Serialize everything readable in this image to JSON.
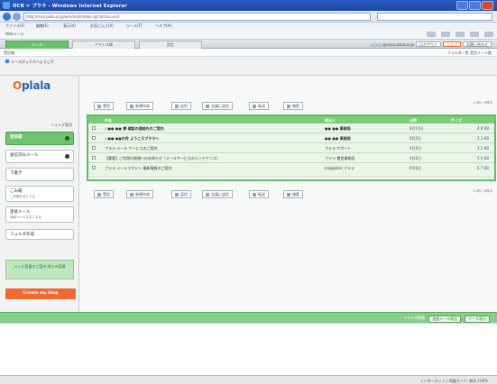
{
  "browser": {
    "title": "OCN  > プララ - Windows Internet Explorer",
    "address": "http://mail.plala.or.jp/wm/mail/index.cgi?action=list",
    "menus": [
      "ファイル(F)",
      "編集(E)",
      "表示(V)",
      "お気に入り(A)",
      "ツール(T)",
      "ヘルプ(H)"
    ],
    "favorite": "Webメール"
  },
  "header": {
    "tabs": [
      "メール",
      "アドレス帳",
      "設定"
    ],
    "links": [
      "ログアウト",
      "ヘルプ",
      "お問い合わせ"
    ],
    "user": "○○○○@xxxx.plala.or.jp",
    "subbar_left": "受信箱",
    "subbar_right": "フォルダ一覧  受信メール数",
    "welcome": "メールボックスへようこそ"
  },
  "sidebar": {
    "logo_part1": "O",
    "logo_part2": "plala",
    "folder_header": "フォルダ管理",
    "items": [
      {
        "label": "受信箱",
        "sub": ""
      },
      {
        "label": "送信済みメール",
        "sub": ""
      },
      {
        "label": "下書き",
        "sub": ""
      },
      {
        "label": "ごみ箱",
        "sub": "ごみ箱を空にする"
      },
      {
        "label": "迷惑メール",
        "sub": "迷惑メールを空にする"
      },
      {
        "label": "フォルダ作成",
        "sub": ""
      }
    ],
    "green_box": "メール容量のご案内 残りの容量",
    "orange_btn": "Create my blog"
  },
  "toolbar": {
    "buttons": [
      "受信",
      "新規作成",
      "返信",
      "全員に返信",
      "転送",
      "検索"
    ],
    "pager": "1-5件 / 5件中"
  },
  "table": {
    "headers": [
      "件名",
      "差出人",
      "日時",
      "サイズ"
    ],
    "rows": [
      {
        "subject": "○●● ●● 様 確認の連絡先のご案内",
        "from": "●● ●● 事務局",
        "date": "9月10日",
        "size": "4.8 KB",
        "unread": true
      },
      {
        "subject": "○●● ●●の件 ようこそプララへ",
        "from": "●● ●● 事務局",
        "date": "9月9日",
        "size": "2.1 KB",
        "unread": true
      },
      {
        "subject": "プララ メール サービスのご案内",
        "from": "プララ サポート",
        "date": "9月9日",
        "size": "3.2 KB",
        "unread": false
      },
      {
        "subject": "【重要】ご利用の皆様へのお知らせ（メールサービスのメンテナンス）",
        "from": "プララ 運営事務局",
        "date": "9月8日",
        "size": "5.0 KB",
        "unread": false
      },
      {
        "subject": "プララ メールマガジン 最新情報のご案内",
        "from": "magazine プララ",
        "date": "9月8日",
        "size": "6.7 KB",
        "unread": false
      }
    ]
  },
  "preview": {
    "buttons": [
      "フォルダ移動",
      "迷惑メール報告",
      "ソース表示"
    ]
  },
  "status": "インターネット | 保護モード: 無効  100%"
}
